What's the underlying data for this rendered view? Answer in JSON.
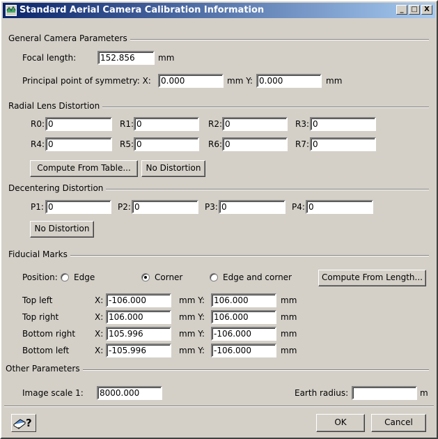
{
  "window": {
    "title": "Standard Aerial Camera Calibration Information",
    "minimize": "_",
    "maximize": "□",
    "close": "X"
  },
  "general": {
    "title": "General Camera Parameters",
    "focal_label": "Focal length:",
    "focal_value": "152.856",
    "focal_unit": "mm",
    "pp_label": "Principal point of symmetry: X:",
    "pp_x": "0.000",
    "pp_mid": "mm  Y:",
    "pp_y": "0.000",
    "pp_unit": "mm"
  },
  "radial": {
    "title": "Radial Lens Distortion",
    "fields": [
      {
        "label": "R0:",
        "value": "0"
      },
      {
        "label": "R1:",
        "value": "0"
      },
      {
        "label": "R2:",
        "value": "0"
      },
      {
        "label": "R3:",
        "value": "0"
      },
      {
        "label": "R4:",
        "value": "0"
      },
      {
        "label": "R5:",
        "value": "0"
      },
      {
        "label": "R6:",
        "value": "0"
      },
      {
        "label": "R7:",
        "value": "0"
      }
    ],
    "compute_button": "Compute From Table...",
    "no_distortion_button": "No Distortion"
  },
  "decentering": {
    "title": "Decentering Distortion",
    "fields": [
      {
        "label": "P1:",
        "value": "0"
      },
      {
        "label": "P2:",
        "value": "0"
      },
      {
        "label": "P3:",
        "value": "0"
      },
      {
        "label": "P4:",
        "value": "0"
      }
    ],
    "no_distortion_button": "No Distortion"
  },
  "fiducial": {
    "title": "Fiducial Marks",
    "position_label": "Position:",
    "options": [
      "Edge",
      "Corner",
      "Edge and corner"
    ],
    "selected": "Corner",
    "compute_button": "Compute From Length...",
    "rows": [
      {
        "label": "Top left",
        "x": "-106.000",
        "y": "106.000"
      },
      {
        "label": "Top right",
        "x": "106.000",
        "y": "106.000"
      },
      {
        "label": "Bottom right",
        "x": "105.996",
        "y": "-106.000"
      },
      {
        "label": "Bottom left",
        "x": "-105.996",
        "y": "-106.000"
      }
    ],
    "x_label": "X:",
    "mid_label": "mm  Y:",
    "unit": "mm"
  },
  "other": {
    "title": "Other Parameters",
    "scale_label": "Image scale  1:",
    "scale_value": "8000.000",
    "earth_label": "Earth radius:",
    "earth_value": "",
    "earth_unit": "m"
  },
  "footer": {
    "ok": "OK",
    "cancel": "Cancel",
    "help_icon": "help-book-icon"
  }
}
